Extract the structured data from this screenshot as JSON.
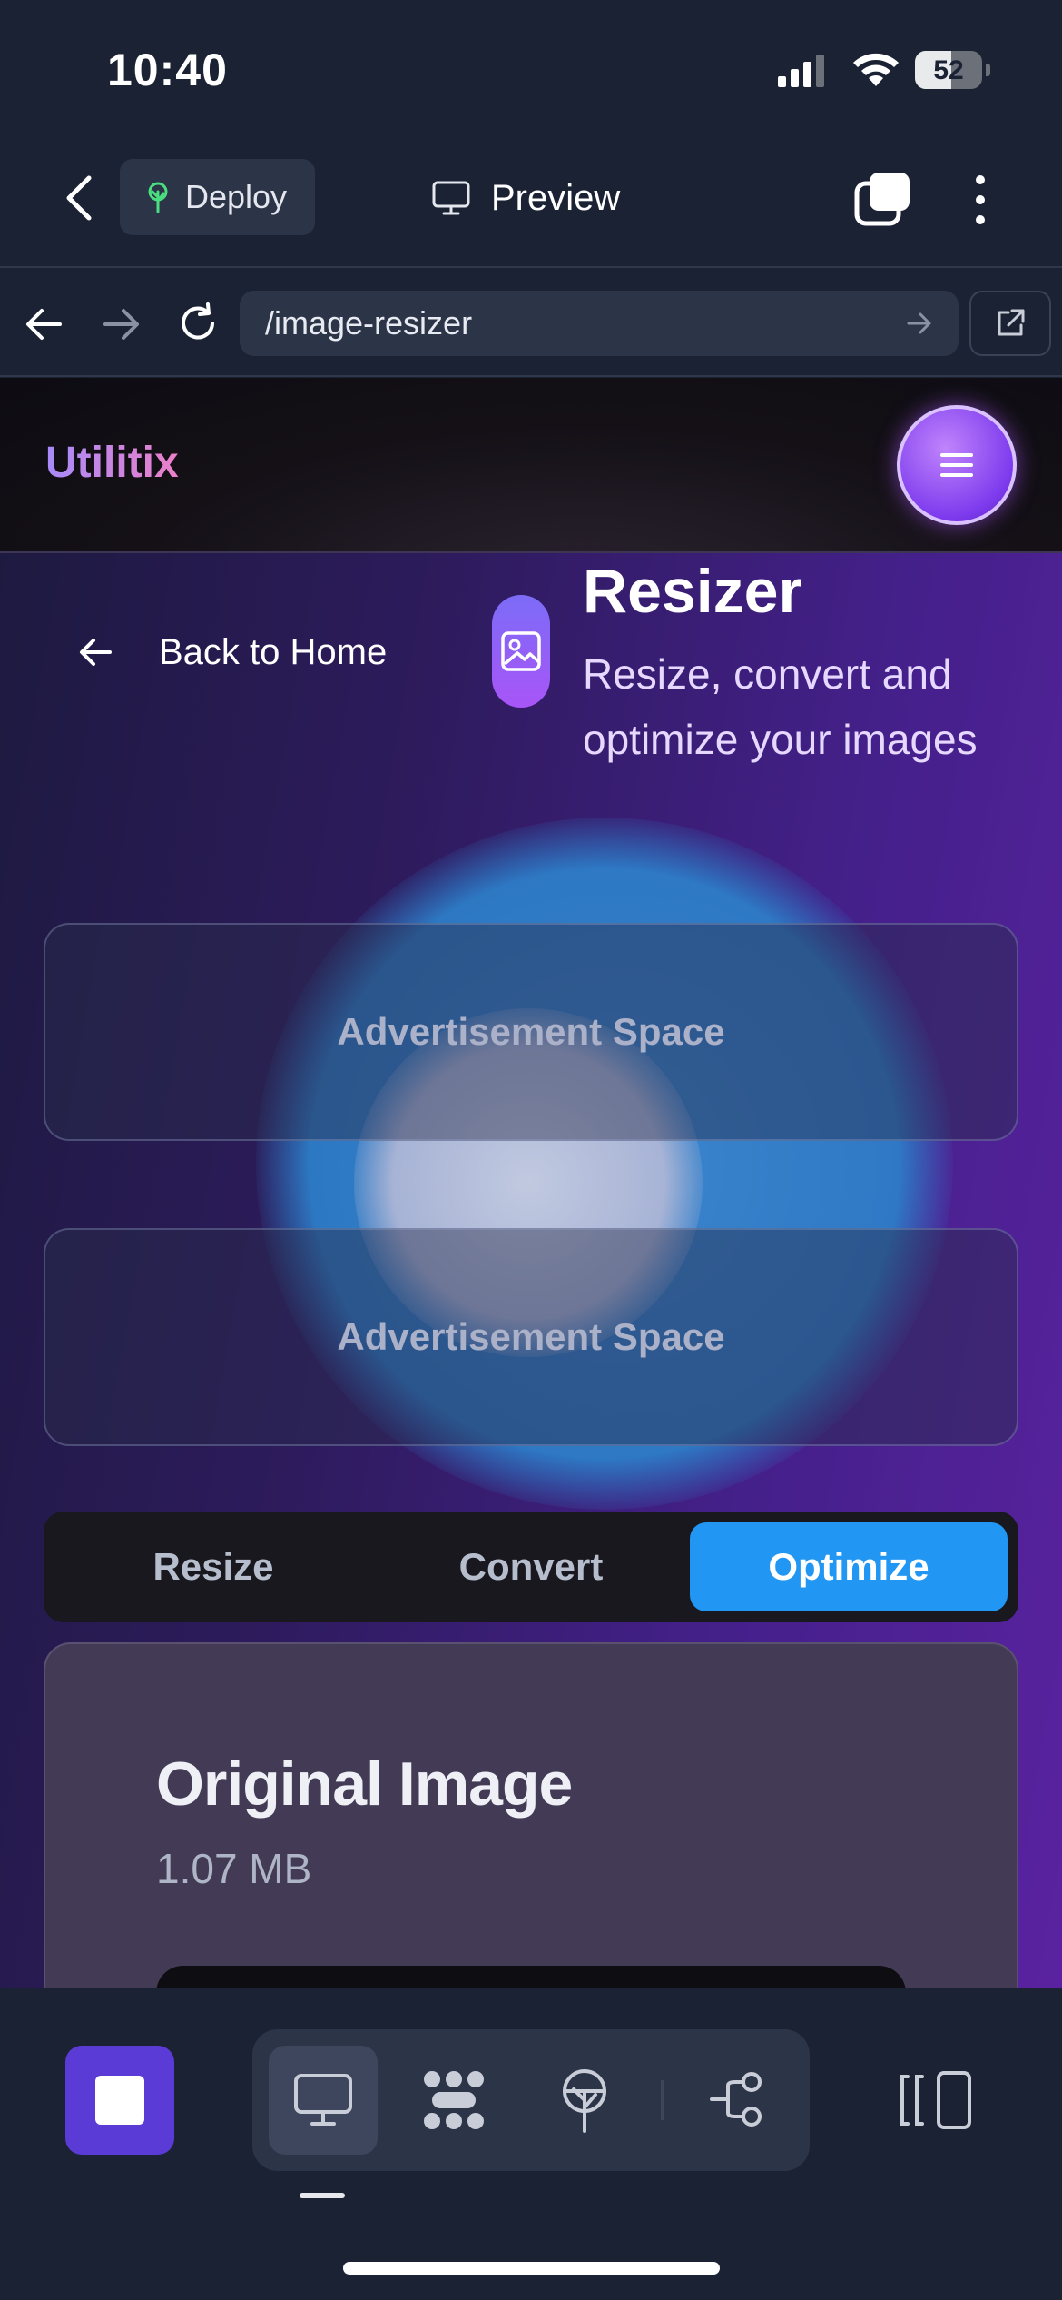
{
  "status_bar": {
    "time": "10:40",
    "battery_level": "52",
    "icons": [
      "cellular-signal-icon",
      "wifi-icon",
      "battery-icon"
    ]
  },
  "toolbar": {
    "deploy_label": "Deploy",
    "preview_label": "Preview",
    "icons": [
      "chevron-left-icon",
      "deploy-tree-icon",
      "monitor-icon",
      "tabs-icon",
      "more-vertical-icon"
    ]
  },
  "url_bar": {
    "url": "/image-resizer",
    "icons": [
      "arrow-left-icon",
      "arrow-right-icon",
      "reload-icon",
      "go-arrow-icon",
      "external-link-icon"
    ]
  },
  "site": {
    "logo": "Utilitix",
    "back_label": "Back to Home",
    "title": "Resizer",
    "subtitle": "Resize, convert and optimize your images",
    "ads": [
      "Advertisement Space",
      "Advertisement Space"
    ],
    "tabs": [
      {
        "label": "Resize",
        "active": false
      },
      {
        "label": "Convert",
        "active": false
      },
      {
        "label": "Optimize",
        "active": true
      }
    ],
    "card": {
      "title": "Original Image",
      "size": "1.07 MB"
    },
    "colors": {
      "logo_gradient_start": "#a78bfa",
      "logo_gradient_end": "#ec7fc9",
      "active_tab": "#2196f3",
      "stop_button": "#5b3bd6"
    }
  },
  "bottom_bar": {
    "icons": [
      "stop-icon",
      "monitor-icon",
      "dots-grid-icon",
      "deploy-tree-icon",
      "git-branch-icon",
      "device-toggle-icon"
    ]
  }
}
